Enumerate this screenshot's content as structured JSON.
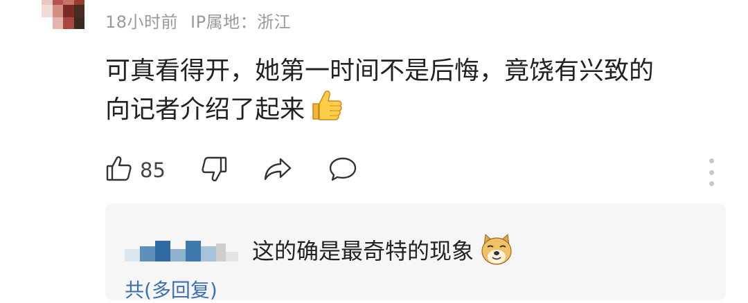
{
  "comment": {
    "time": "18小时前",
    "ip_location": "IP属地：浙江",
    "text_line1": "可真看得开，她第一时间不是后悔，竟饶有兴致的",
    "text_line2": "向记者介绍了起来",
    "like_count": "85"
  },
  "reply": {
    "text": "这的确是最奇特的现象",
    "more_replies": "共(多回复)"
  },
  "colors": {
    "meta_text": "#9a9a9a",
    "body_text": "#222222",
    "reply_bg": "#f6f6f6",
    "link": "#3a6fb5"
  },
  "icons": [
    "thumbs-up-icon",
    "thumbs-down-icon",
    "share-icon",
    "comment-icon",
    "more-vertical-icon",
    "thumbs-up-emoji",
    "doge-emoji"
  ]
}
